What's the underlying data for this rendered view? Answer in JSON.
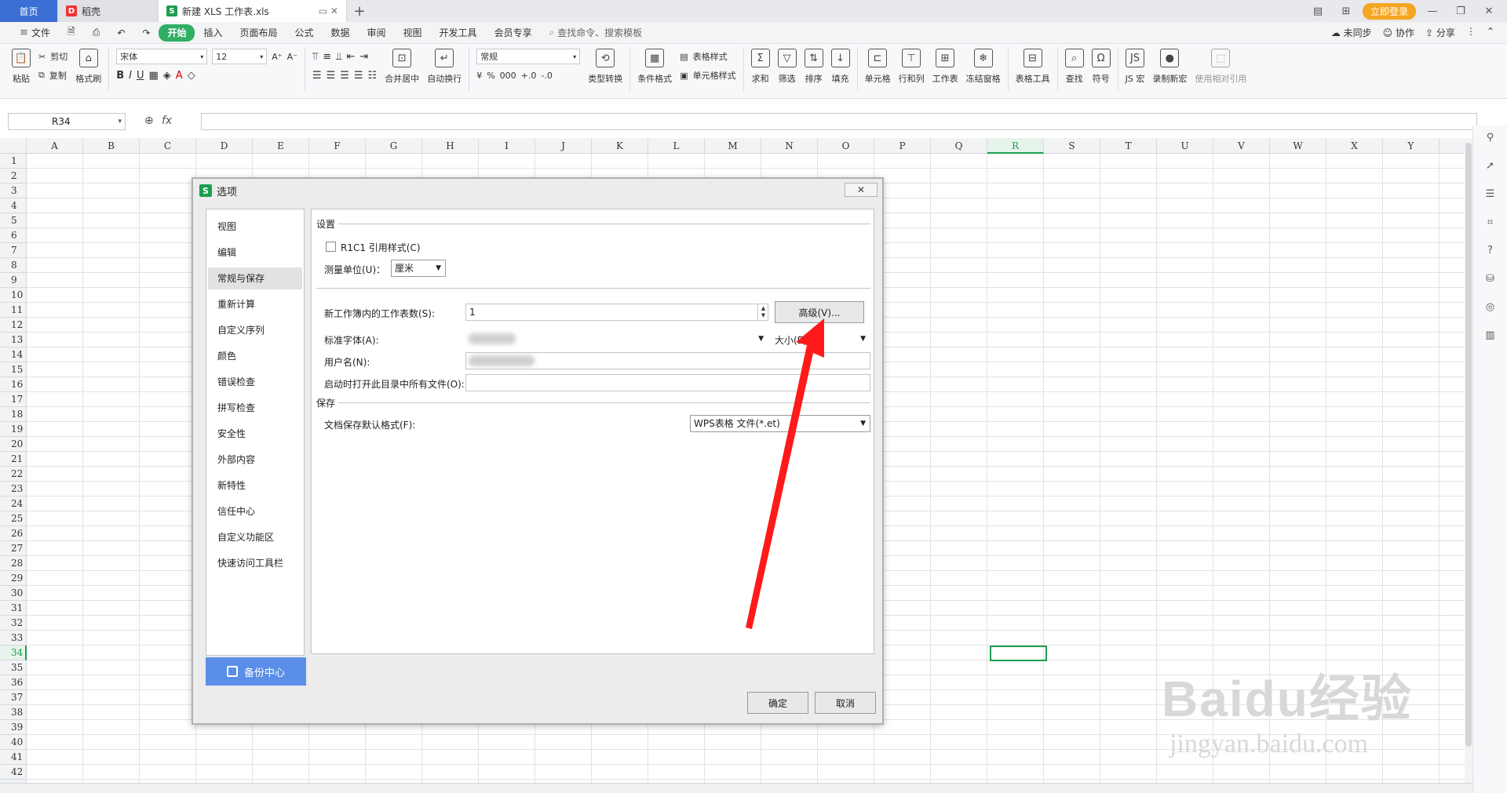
{
  "tabs": [
    {
      "label": "首页",
      "icon": "home-icon"
    },
    {
      "label": "稻壳",
      "icon": "docer-icon"
    },
    {
      "label": "新建 XLS 工作表.xls",
      "icon": "spreadsheet-icon"
    }
  ],
  "tabbar": {
    "add_symbol": "+",
    "login_label": "立即登录"
  },
  "menu": {
    "file_label": "文件",
    "items": [
      "开始",
      "插入",
      "页面布局",
      "公式",
      "数据",
      "审阅",
      "视图",
      "开发工具",
      "会员专享"
    ],
    "search_placeholder": "查找命令、搜索模板",
    "sync_label": "未同步",
    "collab_label": "协作",
    "share_label": "分享"
  },
  "ribbon": {
    "paste": "粘贴",
    "cut": "剪切",
    "copy": "复制",
    "format_painter": "格式刷",
    "font_name": "宋体",
    "font_size": "12",
    "merge_center": "合并居中",
    "wrap_text": "自动换行",
    "number_format": "常规",
    "type_convert": "类型转换",
    "cond_format": "条件格式",
    "table_style": "表格样式",
    "cell_style": "单元格样式",
    "sum": "求和",
    "filter": "筛选",
    "sort": "排序",
    "fill": "填充",
    "cell": "单元格",
    "row_col": "行和列",
    "worksheet": "工作表",
    "freeze": "冻结窗格",
    "table_tools": "表格工具",
    "find": "查找",
    "symbol": "符号",
    "js_macro": "JS 宏",
    "record_macro": "录制新宏",
    "relative_ref": "使用相对引用"
  },
  "formula_bar": {
    "cell_ref": "R34",
    "fx_label": "fx",
    "value": ""
  },
  "sheet": {
    "columns": [
      "A",
      "B",
      "C",
      "D",
      "E",
      "F",
      "G",
      "H",
      "I",
      "J",
      "K",
      "L",
      "M",
      "N",
      "O",
      "P",
      "Q",
      "R",
      "S",
      "T",
      "U",
      "V",
      "W",
      "X",
      "Y"
    ],
    "selected_column": "R",
    "rows": [
      "1",
      "2",
      "3",
      "4",
      "5",
      "6",
      "7",
      "8",
      "9",
      "10",
      "11",
      "12",
      "13",
      "14",
      "15",
      "16",
      "17",
      "18",
      "19",
      "20",
      "21",
      "22",
      "23",
      "24",
      "25",
      "26",
      "27",
      "28",
      "29",
      "30",
      "31",
      "32",
      "33",
      "34",
      "35",
      "36",
      "37",
      "38",
      "39",
      "40",
      "41",
      "42"
    ],
    "selected_row": "34"
  },
  "dialog": {
    "title": "选项",
    "close_label": "✕",
    "nav_items": [
      "视图",
      "编辑",
      "常规与保存",
      "重新计算",
      "自定义序列",
      "颜色",
      "错误检查",
      "拼写检查",
      "安全性",
      "外部内容",
      "新特性",
      "信任中心",
      "自定义功能区",
      "快速访问工具栏"
    ],
    "active_nav": "常规与保存",
    "backup_label": "备份中心",
    "settings_section": "设置",
    "r1c1_label": "R1C1 引用样式(C)",
    "r1c1_checked": false,
    "unit_label": "测量单位(U)：",
    "unit_value": "厘米",
    "sheets_label": "新工作簿内的工作表数(S):",
    "sheets_value": "1",
    "advanced_label": "高级(V)...",
    "std_font_label": "标准字体(A):",
    "size_label": "大小(E):",
    "username_label": "用户名(N):",
    "startup_label": "启动时打开此目录中所有文件(O):",
    "save_section": "保存",
    "save_format_label": "文档保存默认格式(F):",
    "save_format_value": "WPS表格 文件(*.et)",
    "ok_label": "确定",
    "cancel_label": "取消"
  },
  "annotation": {
    "arrow_color": "#ff1a1a"
  },
  "watermark": {
    "brand": "Baidu经验",
    "url": "jingyan.baidu.com"
  },
  "colors": {
    "accent_green": "#1e9e4f",
    "tab_home_blue": "#3b6fd4",
    "menu_active": "#2fae64",
    "login_orange": "#f5a623",
    "backup_blue": "#5b8ee8"
  }
}
